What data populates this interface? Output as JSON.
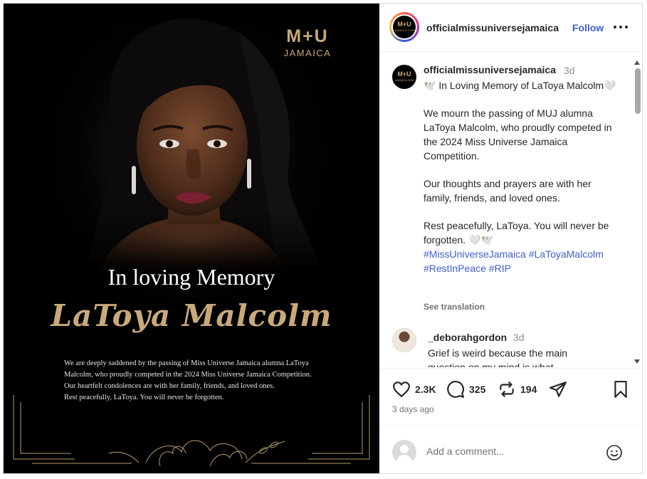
{
  "post": {
    "logo": {
      "mark": "M+U",
      "country": "JAMAICA"
    },
    "heading": "In loving Memory",
    "name": "LaToya Malcolm",
    "body_lines": [
      "We are deeply saddened by the passing of Miss Universe Jamaica alumna LaToya",
      "Malcolm, who proudly competed in the 2024 Miss Universe Jamaica Competition.",
      "Our heartfelt condolences are with her family, friends, and loved ones.",
      "Rest peacefully, LaToya. You will never be forgotten."
    ]
  },
  "header": {
    "username": "officialmissuniversejamaica",
    "follow_label": "Follow",
    "more_icon": "more-horizontal-icon",
    "avatar_text": "M+U",
    "avatar_sub": "JAMAICA 2026"
  },
  "caption": {
    "username": "officialmissuniversejamaica",
    "time": "3d",
    "line1": "🕊️ In Loving Memory of LaToya Malcolm🤍",
    "para1": "We mourn the passing of MUJ alumna LaToya Malcolm, who proudly competed in the 2024 Miss Universe Jamaica Competition.",
    "para2": "Our thoughts and prayers are with her family, friends, and loved ones.",
    "para3": "Rest peacefully, LaToya. You will never be forgotten. 🤍🕊️",
    "hashtags": [
      "#MissUniverseJamaica",
      "#LaToyaMalcolm",
      "#RestInPeace",
      "#RIP"
    ],
    "see_translation": "See translation"
  },
  "comment": {
    "username": "_deborahgordon",
    "time": "3d",
    "text": "Grief is weird because the main question on my mind is what"
  },
  "actions": {
    "likes": "2.3K",
    "comments": "325",
    "reposts": "194",
    "posted_ago": "3 days ago"
  },
  "comment_box": {
    "placeholder": "Add a comment..."
  },
  "colors": {
    "accent_blue": "#3f5ed1",
    "gold": "#c9a97c"
  }
}
